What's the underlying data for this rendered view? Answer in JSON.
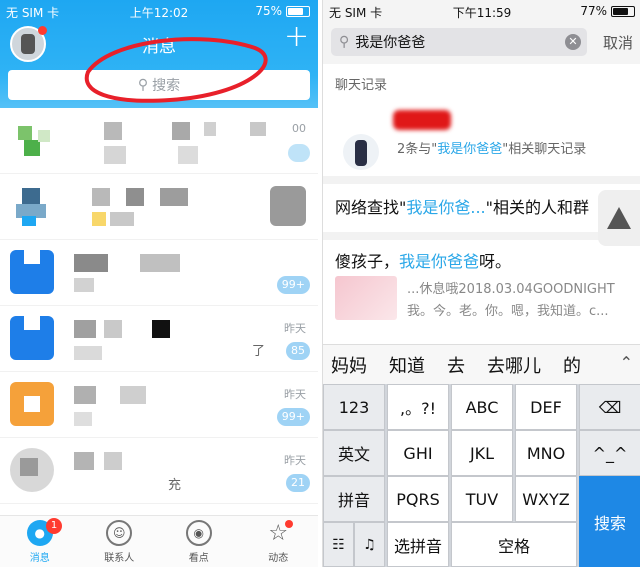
{
  "left": {
    "status": {
      "carrier": "无 SIM 卡",
      "time": "上午12:02",
      "battery": "75%",
      "battery_level": 0.75
    },
    "header": {
      "title": "消息"
    },
    "search": {
      "placeholder": "搜索"
    },
    "rows": [
      {
        "time": "00",
        "badge": ""
      },
      {
        "time": "",
        "badge": ""
      },
      {
        "time": "",
        "badge": "99+"
      },
      {
        "time": "昨天",
        "badge": "85",
        "fragment": "了"
      },
      {
        "time": "昨天",
        "badge": "99+"
      },
      {
        "time": "昨天",
        "badge": "21",
        "fragment": "充"
      }
    ],
    "tabs": [
      {
        "label": "消息",
        "badge": "1"
      },
      {
        "label": "联系人"
      },
      {
        "label": "看点"
      },
      {
        "label": "动态"
      }
    ],
    "colors": {
      "accent": "#1ea7f2",
      "badge_red": "#ff3b30"
    }
  },
  "right": {
    "status": {
      "carrier": "无 SIM 卡",
      "time": "下午11:59",
      "battery": "77%",
      "battery_level": 0.77
    },
    "search": {
      "value": "我是你爸爸",
      "cancel": "取消"
    },
    "section_chat": "聊天记录",
    "chat_result": {
      "count_prefix": "2条与\"",
      "keyword": "我是你爸爸",
      "count_suffix": "\"相关聊天记录"
    },
    "net_search": {
      "prefix": "网络查找\"",
      "keyword": "我是你爸...",
      "suffix": "\"相关的人和群"
    },
    "group": {
      "title_prefix": "傻孩子，",
      "title_keyword": "我是你爸爸",
      "title_suffix": "呀。",
      "line1": "...休息哦2018.03.04GOODNIGHT",
      "line2": "我。今。老。你。嗯，我知道。c..."
    },
    "candidates": [
      "妈妈",
      "知道",
      "去",
      "去哪儿",
      "的"
    ],
    "keyboard": {
      "row1": [
        "123",
        ",。?!",
        "ABC",
        "DEF"
      ],
      "row2": [
        "英文",
        "GHI",
        "JKL",
        "MNO"
      ],
      "row3": [
        "拼音",
        "PQRS",
        "TUV",
        "WXYZ"
      ],
      "space_label": "选拼音",
      "space_key": "空格",
      "search_key": "搜索"
    }
  }
}
